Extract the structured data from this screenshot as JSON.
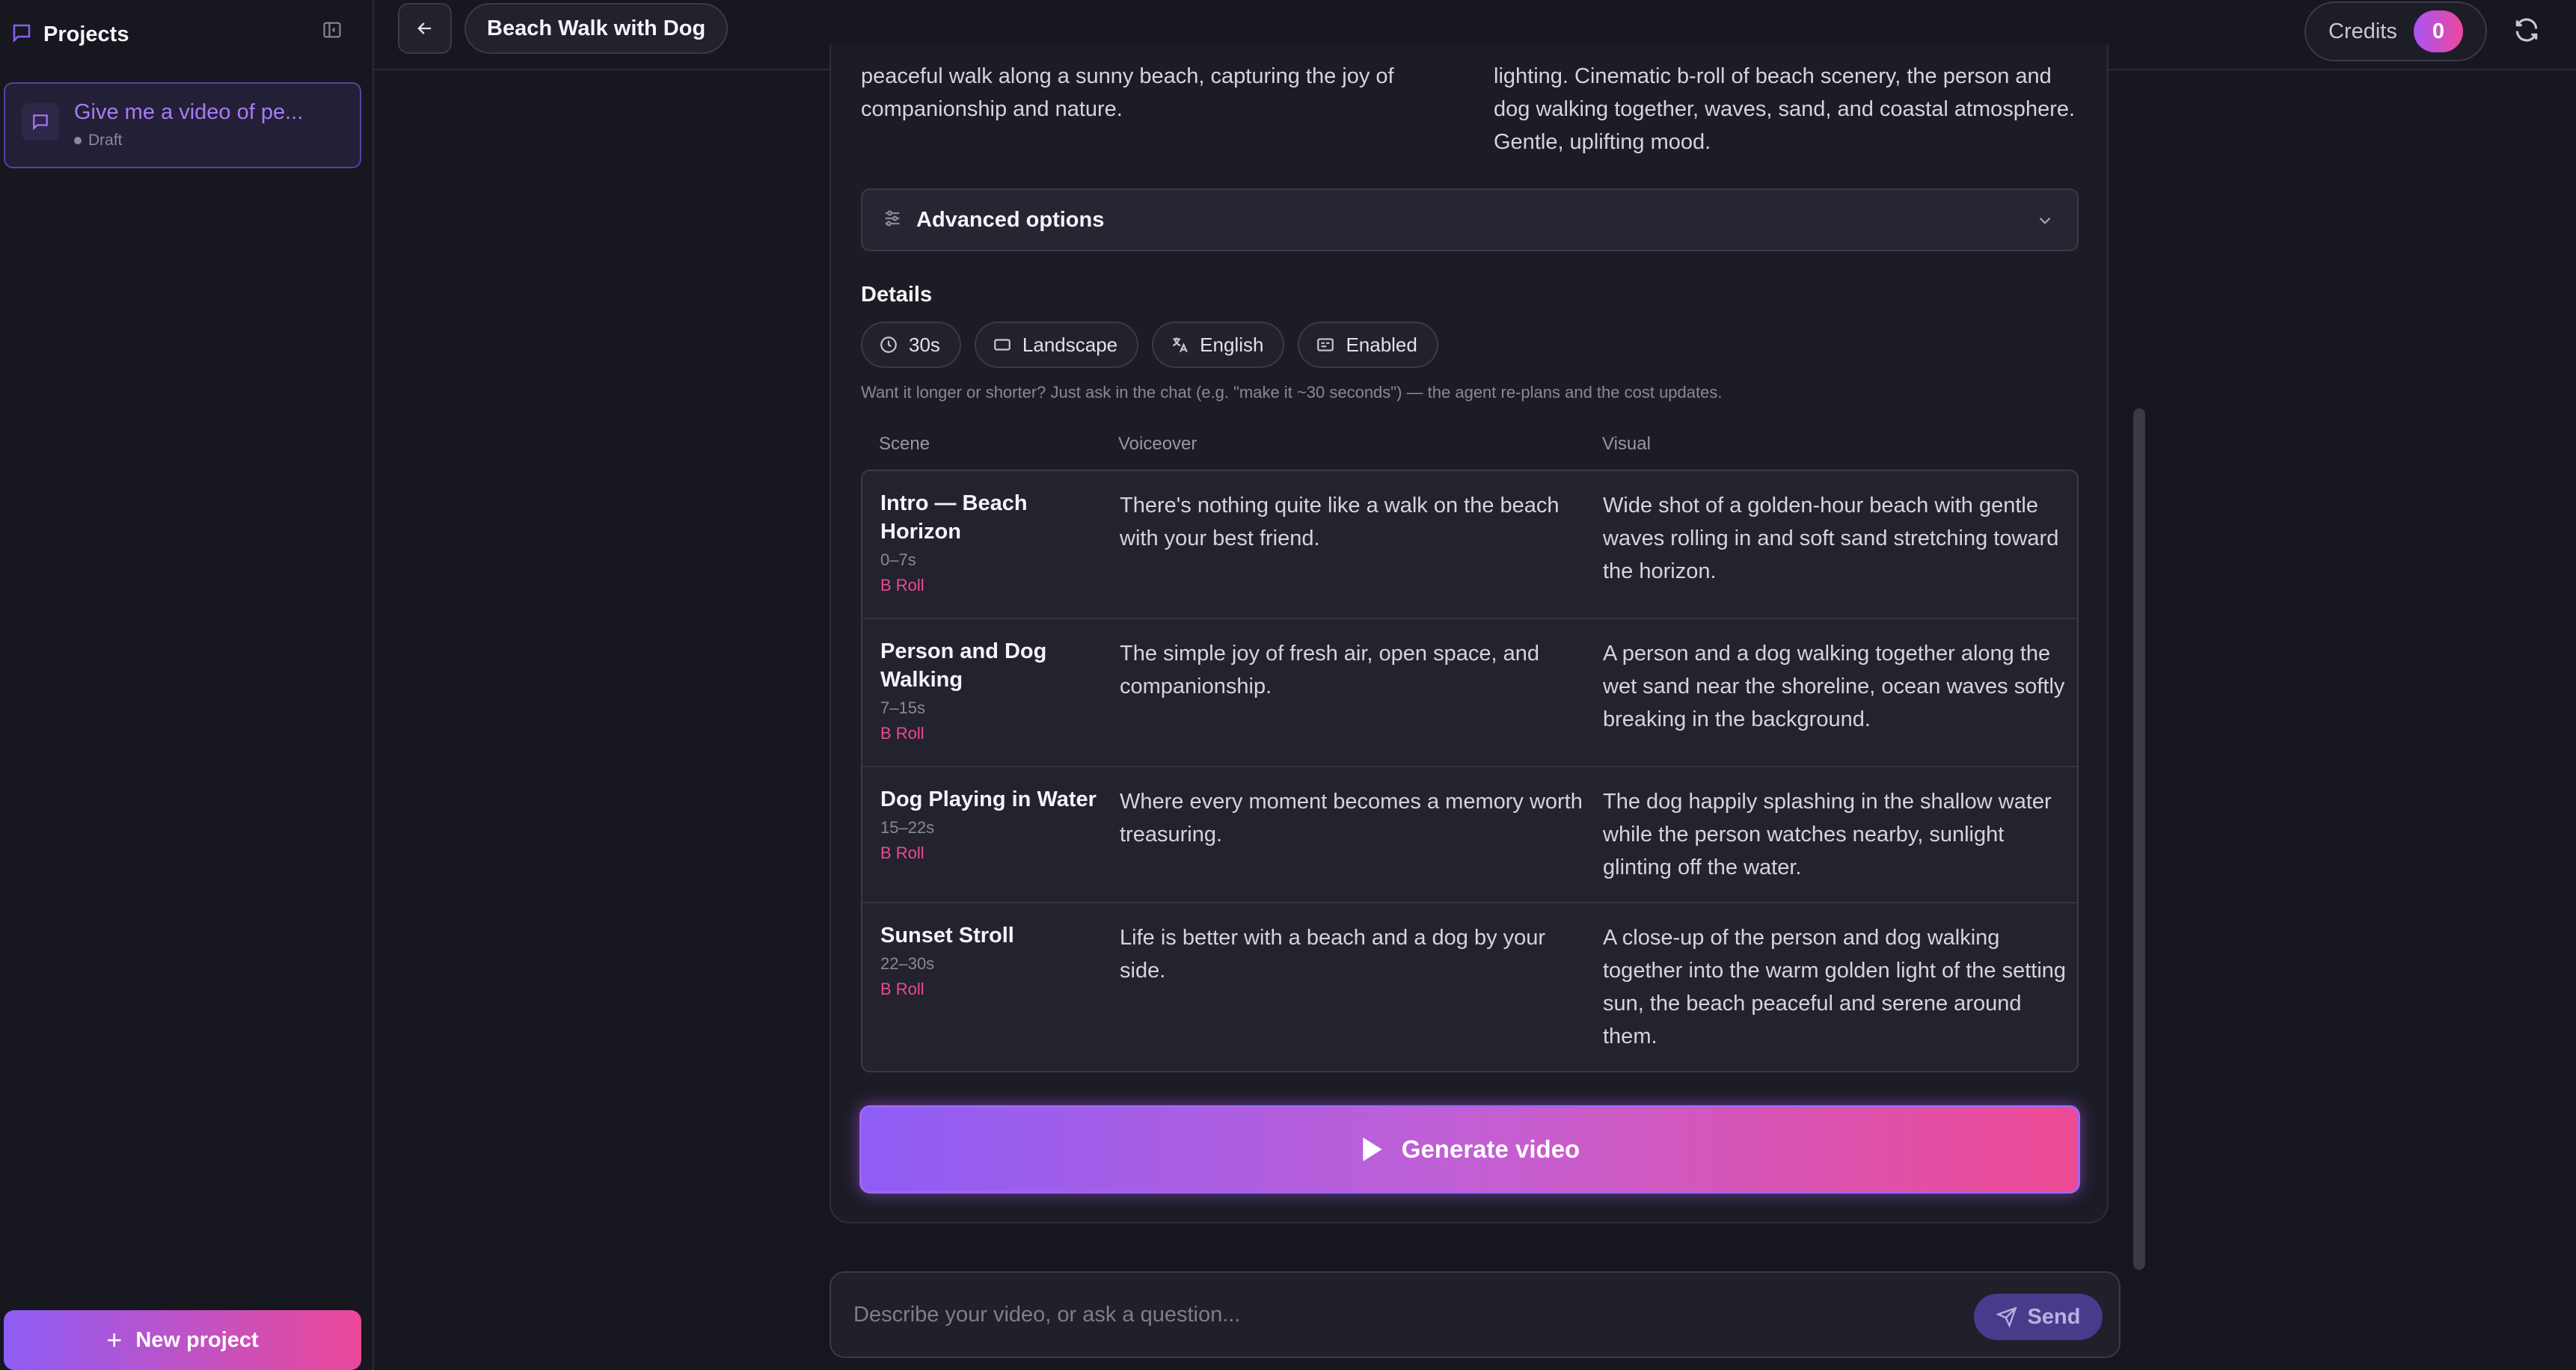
{
  "sidebar": {
    "title": "Projects",
    "projects": [
      {
        "name": "Give me a video of pe...",
        "status": "Draft"
      }
    ],
    "new_project_label": "New project"
  },
  "topbar": {
    "project_title": "Beach Walk with Dog",
    "credits_label": "Credits",
    "credits_value": "0"
  },
  "description": {
    "left": "peaceful walk along a sunny beach, capturing the joy of companionship and nature.",
    "right": "lighting. Cinematic b-roll of beach scenery, the person and dog walking together, waves, sand, and coastal atmosphere. Gentle, uplifting mood."
  },
  "advanced": {
    "label": "Advanced options"
  },
  "details": {
    "title": "Details",
    "chips": [
      {
        "icon": "clock-icon",
        "label": "30s"
      },
      {
        "icon": "landscape-icon",
        "label": "Landscape"
      },
      {
        "icon": "translate-icon",
        "label": "English"
      },
      {
        "icon": "captions-icon",
        "label": "Enabled"
      }
    ],
    "hint": "Want it longer or shorter? Just ask in the chat (e.g. \"make it ~30 seconds\") — the agent re-plans and the cost updates."
  },
  "table": {
    "headers": [
      "Scene",
      "Voiceover",
      "Visual"
    ],
    "rows": [
      {
        "scene": "Intro — Beach Horizon",
        "time": "0–7s",
        "tag": "B Roll",
        "voiceover": "There's nothing quite like a walk on the beach with your best friend.",
        "visual": "Wide shot of a golden-hour beach with gentle waves rolling in and soft sand stretching toward the horizon."
      },
      {
        "scene": "Person and Dog Walking",
        "time": "7–15s",
        "tag": "B Roll",
        "voiceover": "The simple joy of fresh air, open space, and companionship.",
        "visual": "A person and a dog walking together along the wet sand near the shoreline, ocean waves softly breaking in the background."
      },
      {
        "scene": "Dog Playing in Water",
        "time": "15–22s",
        "tag": "B Roll",
        "voiceover": "Where every moment becomes a memory worth treasuring.",
        "visual": "The dog happily splashing in the shallow water while the person watches nearby, sunlight glinting off the water."
      },
      {
        "scene": "Sunset Stroll",
        "time": "22–30s",
        "tag": "B Roll",
        "voiceover": "Life is better with a beach and a dog by your side.",
        "visual": "A close-up of the person and dog walking together into the warm golden light of the setting sun, the beach peaceful and serene around them."
      }
    ]
  },
  "generate_label": "Generate video",
  "chat": {
    "placeholder": "Describe your video, or ask a question...",
    "send_label": "Send"
  },
  "colors": {
    "accent_purple": "#8e5df5",
    "accent_pink": "#ec4899",
    "background": "#16161f"
  }
}
